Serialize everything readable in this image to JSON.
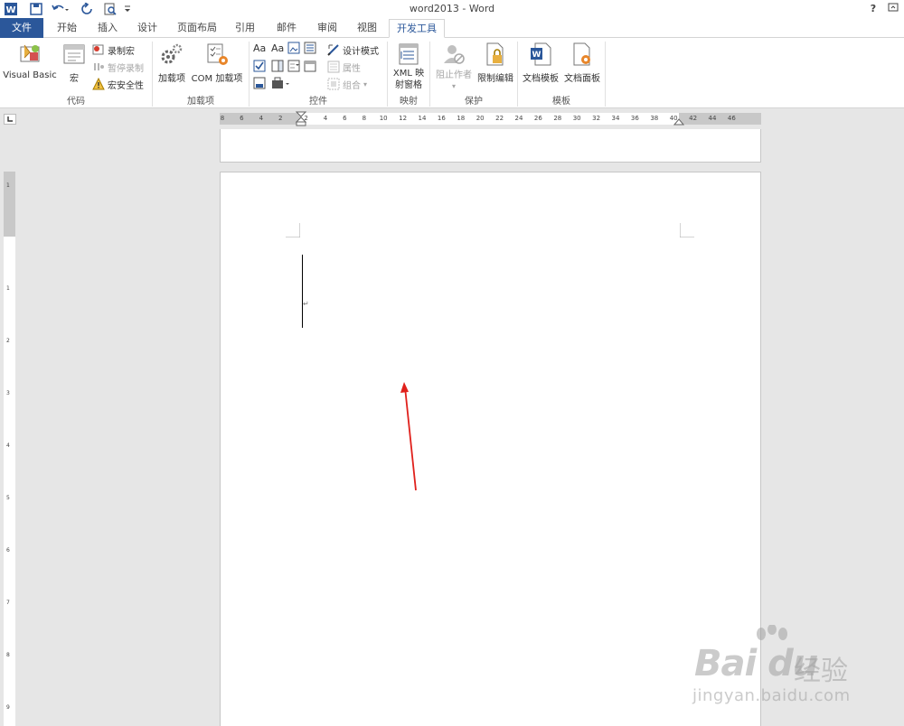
{
  "window": {
    "title": "word2013 - Word",
    "help": "?",
    "restore": "⊡"
  },
  "quick_access": [
    "word-icon",
    "save-icon",
    "undo-icon",
    "redo-icon",
    "print-preview-icon",
    "customize-qat-icon"
  ],
  "tabs": [
    {
      "label": "文件"
    },
    {
      "label": "开始"
    },
    {
      "label": "插入"
    },
    {
      "label": "设计"
    },
    {
      "label": "页面布局"
    },
    {
      "label": "引用"
    },
    {
      "label": "邮件"
    },
    {
      "label": "审阅"
    },
    {
      "label": "视图"
    },
    {
      "label": "开发工具",
      "active": true
    }
  ],
  "ribbon": {
    "code": {
      "label": "代码",
      "visual_basic": "Visual Basic",
      "macros": "宏",
      "record_macro": "录制宏",
      "pause_recording": "暂停录制",
      "macro_security": "宏安全性"
    },
    "addins": {
      "label": "加载项",
      "addins": "加载项",
      "com_addins": "COM 加载项"
    },
    "controls": {
      "label": "控件",
      "design_mode": "设计模式",
      "properties": "属性",
      "group": "组合"
    },
    "mapping": {
      "label": "映射",
      "xml_line1": "XML 映",
      "xml_line2": "射窗格"
    },
    "protect": {
      "label": "保护",
      "block_authors": "阻止作者",
      "restrict_editing": "限制编辑"
    },
    "templates": {
      "label": "模板",
      "document_template": "文档模板",
      "document_panel": "文档面板"
    }
  },
  "ruler": {
    "horizontal_ticks": [
      "8",
      "6",
      "4",
      "2",
      "2",
      "4",
      "6",
      "8",
      "10",
      "12",
      "14",
      "16",
      "18",
      "20",
      "22",
      "24",
      "26",
      "28",
      "30",
      "32",
      "34",
      "36",
      "38",
      "40",
      "42",
      "44",
      "46"
    ],
    "vertical_ticks": [
      "1",
      "1",
      "2",
      "3",
      "4",
      "5",
      "6",
      "7",
      "8",
      "9"
    ]
  },
  "document": {
    "paragraph_mark": "↵"
  },
  "watermark": {
    "logo": "Bai du",
    "jingyan": "经验",
    "url": "jingyan.baidu.com"
  },
  "colors": {
    "accent": "#2b579a",
    "annotation_arrow": "#e0211c"
  }
}
